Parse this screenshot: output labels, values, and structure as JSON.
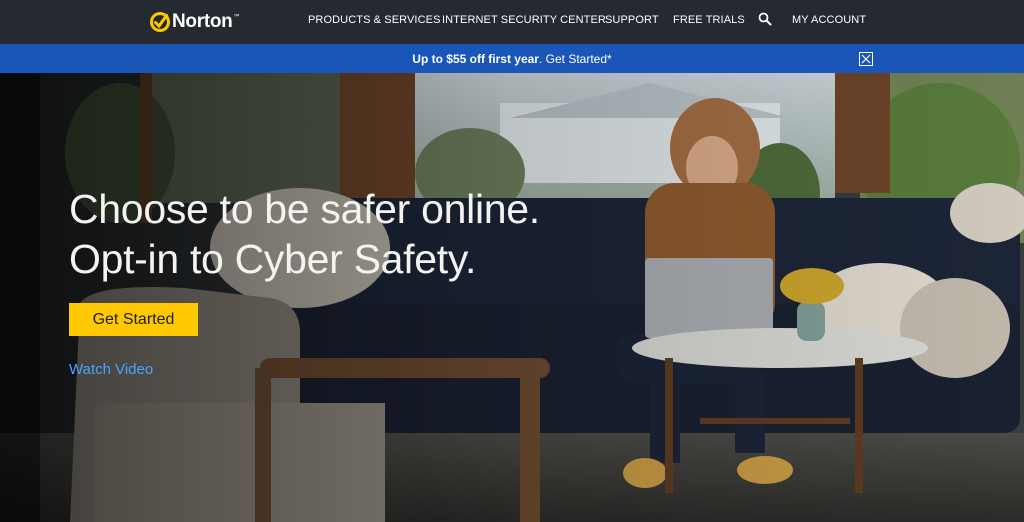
{
  "header": {
    "brand": "Norton",
    "nav": [
      {
        "label": "PRODUCTS & SERVICES"
      },
      {
        "label": "INTERNET SECURITY CENTER"
      },
      {
        "label": "SUPPORT"
      },
      {
        "label": "FREE TRIALS"
      },
      {
        "label": "MY ACCOUNT"
      }
    ],
    "search_icon": "search-icon"
  },
  "promo": {
    "offer": "Up to $55 off first year",
    "link": "Get Started*",
    "close_icon": "close-icon"
  },
  "hero": {
    "headline_line1": "Choose to be safer online.",
    "headline_line2": "Opt-in to Cyber Safety.",
    "cta_label": "Get Started",
    "video_link": "Watch Video"
  },
  "colors": {
    "nav_bg": "#242a30",
    "promo_bg": "#1a55b8",
    "cta_yellow": "#ffc800",
    "link_blue": "#4aa3ff"
  }
}
